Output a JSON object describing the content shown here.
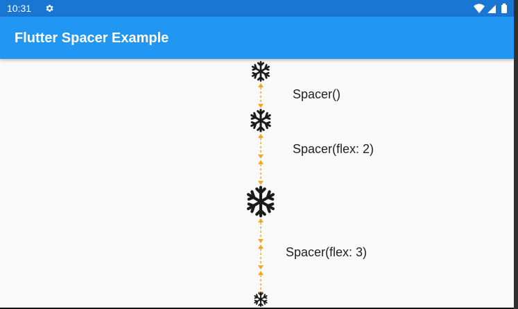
{
  "status_bar": {
    "time": "10:31",
    "icons": [
      "gear-icon",
      "wifi-icon",
      "signal-icon",
      "battery-icon"
    ],
    "color": "#1976d2"
  },
  "app_bar": {
    "title": "Flutter Spacer Example",
    "color": "#2196f3"
  },
  "content": {
    "icon": "snowflake-icon",
    "arrow_color": "#f5a623",
    "spacers": [
      {
        "label": "Spacer()"
      },
      {
        "label": "Spacer(flex: 2)"
      },
      {
        "label": "Spacer(flex: 3)"
      }
    ]
  }
}
